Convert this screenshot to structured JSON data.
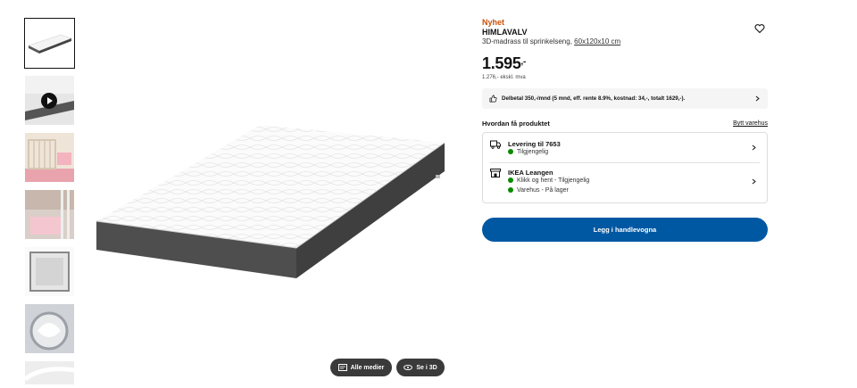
{
  "thumbnails": [
    {
      "name": "thumbnail-mattress",
      "kind": "mattress",
      "active": true
    },
    {
      "name": "thumbnail-video",
      "kind": "video",
      "active": false
    },
    {
      "name": "thumbnail-crib-room",
      "kind": "crib",
      "active": false
    },
    {
      "name": "thumbnail-crib-detail",
      "kind": "crib-detail",
      "active": false
    },
    {
      "name": "thumbnail-mattress-top",
      "kind": "mattress-top",
      "active": false
    },
    {
      "name": "thumbnail-washing-machine",
      "kind": "washer",
      "active": false
    },
    {
      "name": "thumbnail-fabric",
      "kind": "fabric",
      "active": false
    }
  ],
  "media": {
    "all_media_label": "Alle medier",
    "view_3d_label": "Se i 3D"
  },
  "product": {
    "badge": "Nyhet",
    "name": "HIMLAVALV",
    "description": "3D-madrass til sprinkelseng,",
    "dimensions": "60x120x10 cm",
    "price_main": "1.595",
    "price_suffix": ",-",
    "price_ex_vat": "1.276,- ekskl. mva"
  },
  "finance": {
    "text": "Delbetal 350,-/mnd (5 mnd, eff. rente 8.9%, kostnad: 34,-, totalt 1629,-)."
  },
  "fulfilment": {
    "heading": "Hvordan få produktet",
    "change_store": "Bytt varehus",
    "delivery": {
      "title": "Levering til 7653",
      "status": "Tilgjengelig"
    },
    "store": {
      "title": "IKEA Leangen",
      "click_collect": "Klikk og hent - Tilgjengelig",
      "in_store": "Varehus - På lager"
    }
  },
  "cart": {
    "label": "Legg i handlevogna"
  },
  "colors": {
    "accent_blue": "#0058a3",
    "new_orange": "#ca5008",
    "available_green": "#0a8a00"
  }
}
